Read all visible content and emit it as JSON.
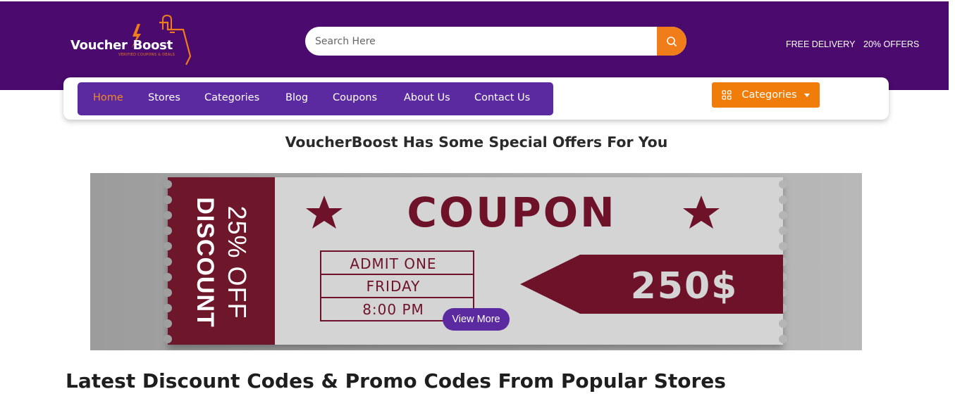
{
  "brand": {
    "name_part1": "Voucher",
    "name_part2": "Boost",
    "tagline": "VERIFIED COUPONS & DEALS"
  },
  "search": {
    "placeholder": "Search Here",
    "button_icon": "search-icon"
  },
  "top_links": {
    "free_delivery": "FREE DELIVERY",
    "offers": "20% OFFERS"
  },
  "nav": {
    "items": [
      {
        "label": "Home",
        "active": true
      },
      {
        "label": "Stores",
        "active": false
      },
      {
        "label": "Categories",
        "active": false
      },
      {
        "label": "Blog",
        "active": false
      },
      {
        "label": "Coupons",
        "active": false
      },
      {
        "label": "About Us",
        "active": false
      },
      {
        "label": "Contact Us",
        "active": false
      }
    ],
    "categories_button": "Categories"
  },
  "special_heading": "VoucherBoost Has Some Special Offers For You",
  "banner": {
    "side_top": "25% OFF",
    "side_bottom": "DISCOUNT",
    "title": "COUPON",
    "ticket_lines": [
      "ADMIT ONE",
      "FRIDAY",
      "8:00 PM"
    ],
    "price": "250$",
    "view_more": "View More"
  },
  "latest_heading": "Latest Discount Codes & Promo Codes From Popular Stores",
  "colors": {
    "header_purple": "#4a0a6e",
    "nav_purple": "#5b2aa0",
    "accent_orange": "#f07d1a",
    "coupon_maroon": "#6e1229",
    "coupon_paper": "#d4d4d4"
  }
}
